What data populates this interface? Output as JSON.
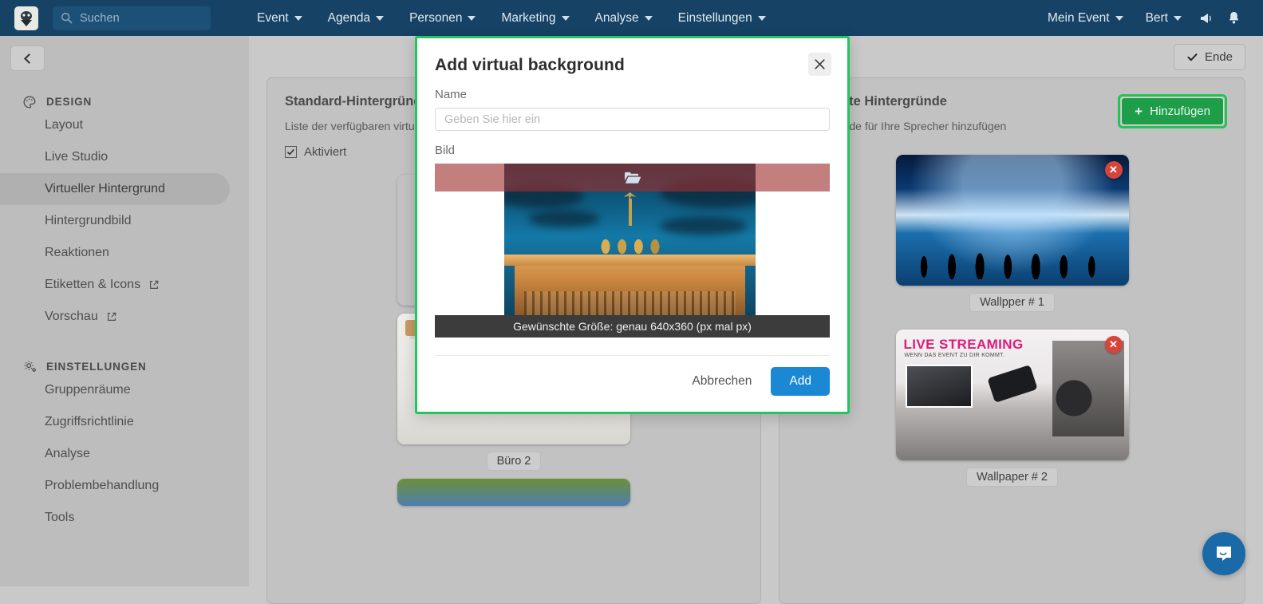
{
  "topnav": {
    "logo_icon": "app-logo-icon",
    "search": {
      "placeholder": "Suchen",
      "value": "",
      "icon": "search-icon"
    },
    "menu": [
      {
        "label": "Event"
      },
      {
        "label": "Agenda"
      },
      {
        "label": "Personen"
      },
      {
        "label": "Marketing"
      },
      {
        "label": "Analyse"
      },
      {
        "label": "Einstellungen"
      }
    ],
    "right": {
      "event_selector": "Mein Event",
      "user": "Bert",
      "announcement_icon": "megaphone-icon",
      "notifications_icon": "bell-icon"
    }
  },
  "sidebar": {
    "back_button_icon": "chevron-left-icon",
    "sections": [
      {
        "title": "DESIGN",
        "icon": "palette-icon",
        "items": [
          {
            "label": "Layout",
            "active": false,
            "external": false
          },
          {
            "label": "Live Studio",
            "active": false,
            "external": false
          },
          {
            "label": "Virtueller Hintergrund",
            "active": true,
            "external": false
          },
          {
            "label": "Hintergrundbild",
            "active": false,
            "external": false
          },
          {
            "label": "Reaktionen",
            "active": false,
            "external": false
          },
          {
            "label": "Etiketten & Icons",
            "active": false,
            "external": true
          },
          {
            "label": "Vorschau",
            "active": false,
            "external": true
          }
        ]
      },
      {
        "title": "EINSTELLUNGEN",
        "icon": "gear-icon",
        "items": [
          {
            "label": "Gruppenräume",
            "active": false,
            "external": false
          },
          {
            "label": "Zugriffsrichtlinie",
            "active": false,
            "external": false
          },
          {
            "label": "Analyse",
            "active": false,
            "external": false
          },
          {
            "label": "Problembehandlung",
            "active": false,
            "external": false
          },
          {
            "label": "Tools",
            "active": false,
            "external": false
          }
        ]
      }
    ]
  },
  "main": {
    "end_button": {
      "label": "Ende",
      "icon": "check-icon"
    },
    "left_panel": {
      "title": "Standard-Hintergründe",
      "subtitle": "Liste der verfügbaren virtuellen Hintergründe",
      "checkbox_label": "Aktiviert",
      "checkbox_checked": true,
      "items": [
        {
          "label": "",
          "art": "wood"
        },
        {
          "label": "Büro 2",
          "art": "office"
        }
      ]
    },
    "right_panel": {
      "title": "Erweiterte Hintergründe",
      "title_visible_part": "erte Hintergründe",
      "subtitle": "Hintergründe für Ihre Sprecher hinzufügen",
      "add_button": {
        "label": "Hinzufügen",
        "icon": "plus-icon",
        "highlighted": true
      },
      "items": [
        {
          "label": "Wallpper # 1",
          "art": "globe",
          "delete_icon": "close-circle-icon"
        },
        {
          "label": "Wallpaper # 2",
          "art": "live",
          "delete_icon": "close-circle-icon"
        }
      ]
    }
  },
  "modal": {
    "highlighted": true,
    "title": "Add virtual background",
    "close_icon": "close-icon",
    "name_label": "Name",
    "name_placeholder": "Geben Sie hier ein",
    "name_value": "",
    "image_label": "Bild",
    "upload_icon": "folder-open-icon",
    "image_caption": "Gewünschte Größe: genau 640x360 (px mal px)",
    "cancel_label": "Abbrechen",
    "submit_label": "Add"
  },
  "intercom": {
    "icon": "chat-bubble-icon"
  },
  "colors": {
    "navbar": "#154265",
    "highlight_green": "#22c55e",
    "add_button_green": "#1f9e4a",
    "submit_blue": "#1b88d3",
    "delete_red": "#d6453b",
    "page_bg": "#c9c9c9"
  }
}
